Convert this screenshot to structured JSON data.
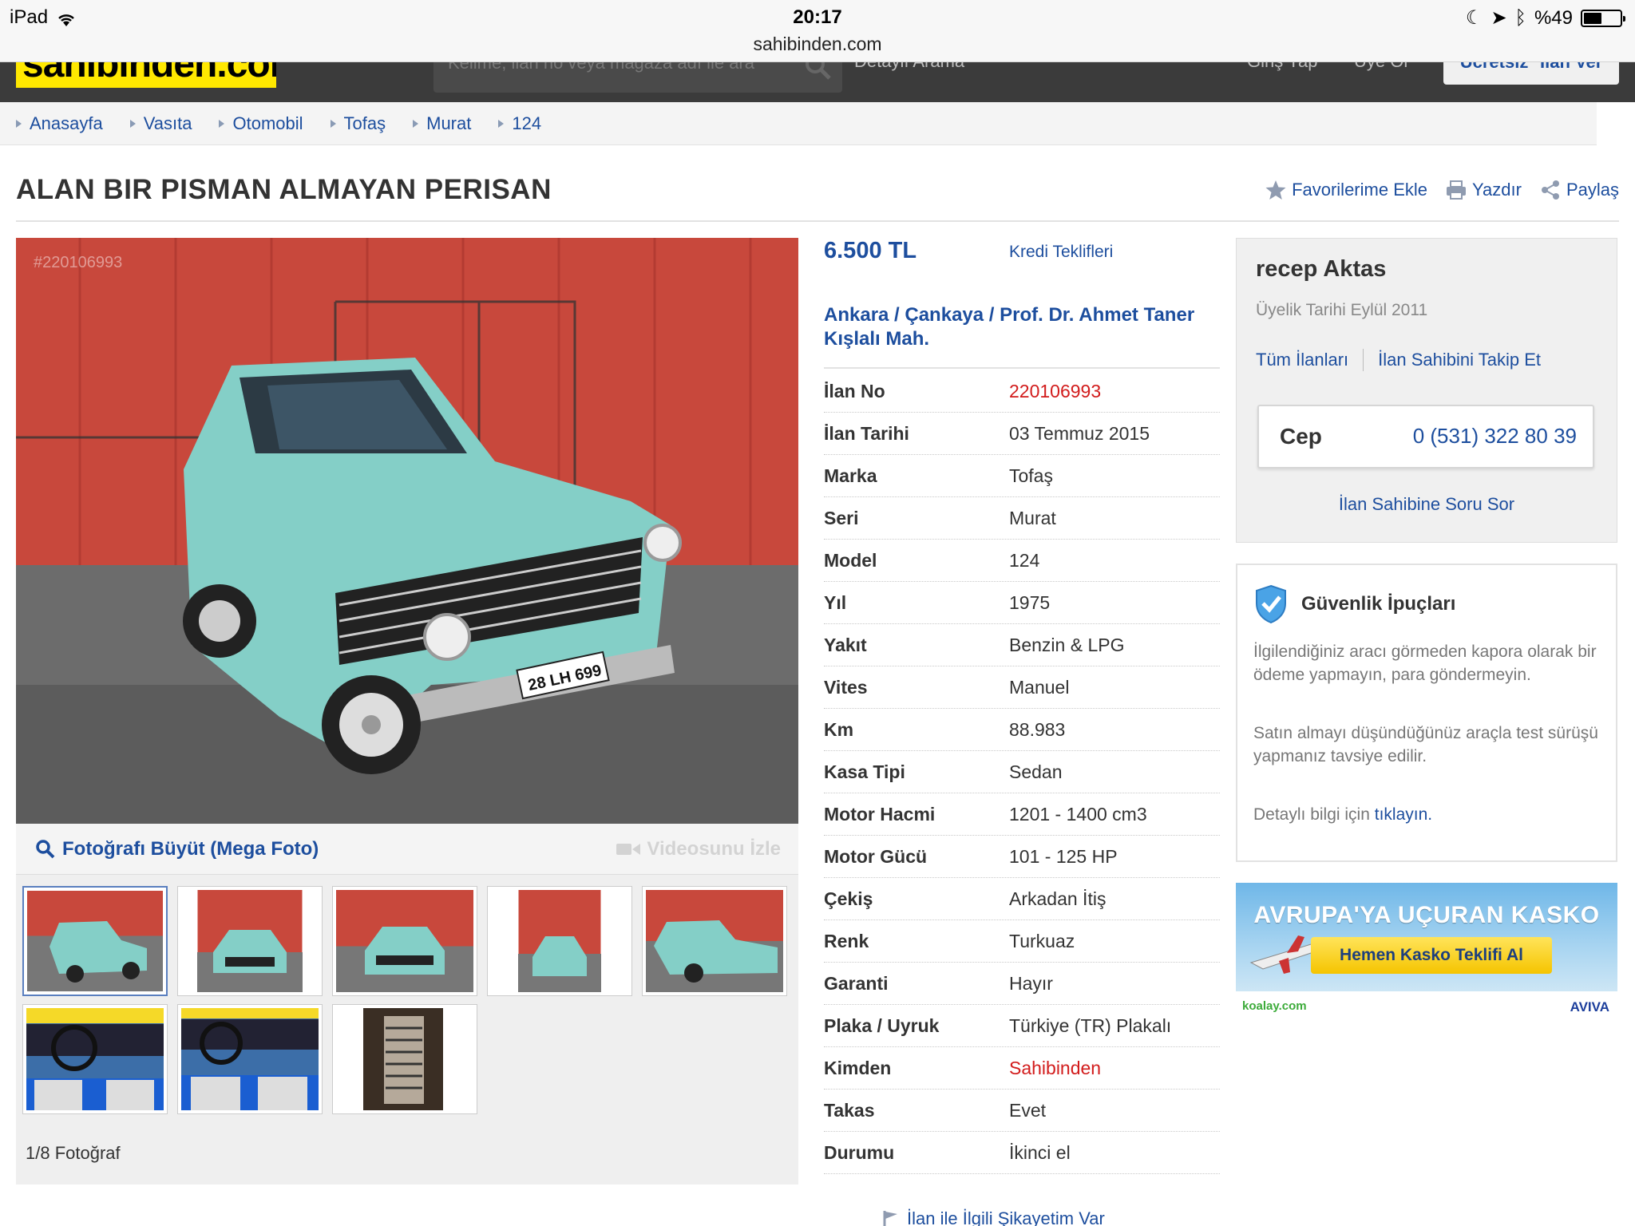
{
  "status_bar": {
    "device": "iPad",
    "time": "20:17",
    "url": "sahibinden.com",
    "battery": "%49",
    "battery_level": 0.49
  },
  "header": {
    "logo": "sahibinden.com",
    "search_placeholder": "Kelime, ilan no veya mağaza adı ile ara",
    "detailed_search": "Detaylı Arama",
    "login": "Giriş Yap",
    "register": "Üye Ol",
    "post_ad": "Ücretsiz* İlan Ver"
  },
  "breadcrumb": [
    "Anasayfa",
    "Vasıta",
    "Otomobil",
    "Tofaş",
    "Murat",
    "124"
  ],
  "listing": {
    "title": "ALAN BIR PISMAN ALMAYAN PERISAN",
    "actions": {
      "favorite": "Favorilerime Ekle",
      "print": "Yazdır",
      "share": "Paylaş"
    },
    "price": "6.500 TL",
    "credit": "Kredi Teklifleri",
    "location": "Ankara  /  Çankaya  /  Prof. Dr. Ahmet Taner Kışlalı Mah.",
    "details": [
      {
        "key": "İlan No",
        "value": "220106993"
      },
      {
        "key": "İlan Tarihi",
        "value": "03 Temmuz 2015"
      },
      {
        "key": "Marka",
        "value": "Tofaş"
      },
      {
        "key": "Seri",
        "value": "Murat"
      },
      {
        "key": "Model",
        "value": "124"
      },
      {
        "key": "Yıl",
        "value": "1975"
      },
      {
        "key": "Yakıt",
        "value": "Benzin & LPG"
      },
      {
        "key": "Vites",
        "value": "Manuel"
      },
      {
        "key": "Km",
        "value": "88.983"
      },
      {
        "key": "Kasa Tipi",
        "value": "Sedan"
      },
      {
        "key": "Motor Hacmi",
        "value": "1201 - 1400 cm3"
      },
      {
        "key": "Motor Gücü",
        "value": "101 - 125 HP"
      },
      {
        "key": "Çekiş",
        "value": "Arkadan İtiş"
      },
      {
        "key": "Renk",
        "value": "Turkuaz"
      },
      {
        "key": "Garanti",
        "value": "Hayır"
      },
      {
        "key": "Plaka / Uyruk",
        "value": "Türkiye (TR) Plakalı"
      },
      {
        "key": "Kimden",
        "value": "Sahibinden"
      },
      {
        "key": "Takas",
        "value": "Evet"
      },
      {
        "key": "Durumu",
        "value": "İkinci el"
      }
    ],
    "complaint": "İlan ile İlgili Şikayetim Var"
  },
  "gallery": {
    "watermark": "#220106993",
    "plate": "28 LH 699",
    "enlarge": "Fotoğrafı Büyüt (Mega Foto)",
    "video": "Videosunu İzle",
    "count": "1/8 Fotoğraf"
  },
  "seller": {
    "name": "recep Aktas",
    "member_since": "Üyelik Tarihi  Eylül 2011",
    "all_ads": "Tüm İlanları",
    "follow": "İlan Sahibini Takip Et",
    "phone_label": "Cep",
    "phone": "0 (531) 322 80 39",
    "ask": "İlan Sahibine Soru Sor"
  },
  "safety": {
    "title": "Güvenlik İpuçları",
    "tip1": "İlgilendiğiniz aracı görmeden kapora olarak bir ödeme yapmayın, para göndermeyin.",
    "tip2": "Satın almayı düşündüğünüz araçla test sürüşü yapmanız tavsiye edilir.",
    "tip3_prefix": "Detaylı bilgi için",
    "tip3_link": "tıklayın."
  },
  "ad": {
    "title": "AVRUPA'YA UÇURAN KASKO",
    "button": "Hemen Kasko Teklifi Al",
    "partner_left": "koalay.com",
    "partner_right": "AVIVA"
  },
  "colors": {
    "link": "#1d4e9e",
    "accent_red": "#d21c1c",
    "logo_yellow": "#ffe800",
    "car": "#7fcdc6"
  }
}
